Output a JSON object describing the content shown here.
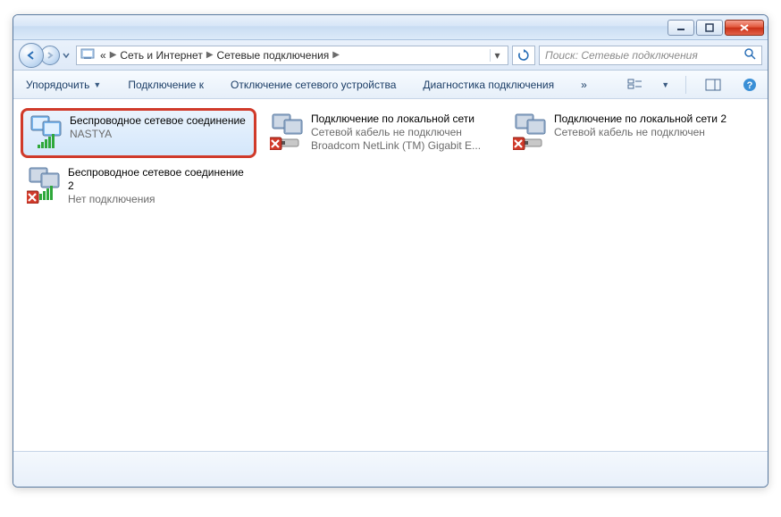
{
  "breadcrumbs": {
    "prefix": "«",
    "level1": "Сеть и Интернет",
    "level2": "Сетевые подключения"
  },
  "search": {
    "placeholder": "Поиск: Сетевые подключения"
  },
  "toolbar": {
    "organize": "Упорядочить",
    "connect_to": "Подключение к",
    "disable_device": "Отключение сетевого устройства",
    "diagnostics": "Диагностика подключения",
    "more": "»"
  },
  "connections": [
    {
      "title": "Беспроводное сетевое соединение",
      "line2": "NASTYA",
      "line3": "",
      "type": "wifi",
      "status": "connected",
      "highlight": true
    },
    {
      "title": "Подключение по локальной сети",
      "line2": "Сетевой кабель не подключен",
      "line3": "Broadcom NetLink (TM) Gigabit E...",
      "type": "lan",
      "status": "disconnected",
      "highlight": false
    },
    {
      "title": "Подключение по локальной сети 2",
      "line2": "Сетевой кабель не подключен",
      "line3": "",
      "type": "lan",
      "status": "disconnected",
      "highlight": false
    },
    {
      "title": "Беспроводное сетевое соединение 2",
      "line2": "Нет подключения",
      "line3": "",
      "type": "wifi",
      "status": "disconnected",
      "highlight": false
    }
  ]
}
